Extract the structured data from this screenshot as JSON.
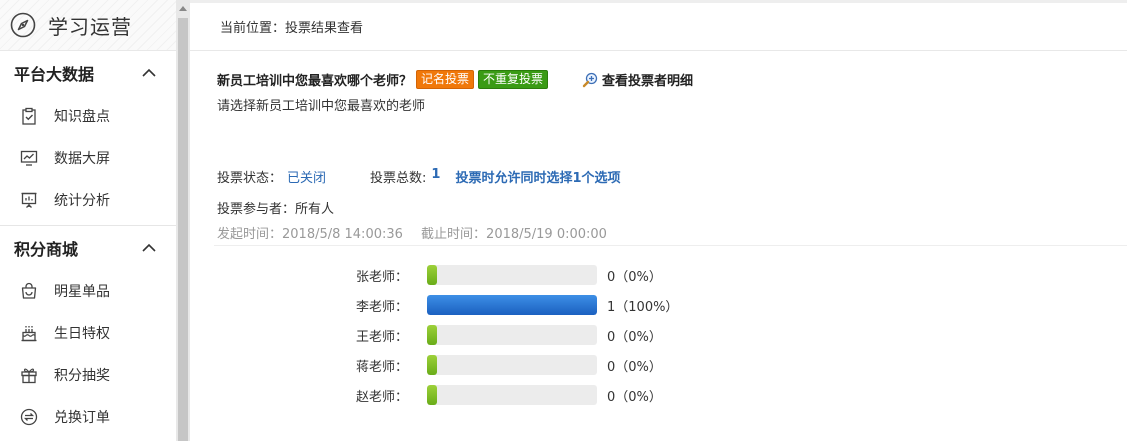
{
  "sidebar": {
    "app_title": "学习运营",
    "sections": [
      {
        "title": "平台大数据",
        "items": [
          {
            "label": "知识盘点",
            "icon": "clipboard-check-icon"
          },
          {
            "label": "数据大屏",
            "icon": "monitor-chart-icon"
          },
          {
            "label": "统计分析",
            "icon": "presentation-board-icon"
          }
        ]
      },
      {
        "title": "积分商城",
        "items": [
          {
            "label": "明星单品",
            "icon": "shopping-bag-icon"
          },
          {
            "label": "生日特权",
            "icon": "birthday-cake-icon"
          },
          {
            "label": "积分抽奖",
            "icon": "gift-box-icon"
          },
          {
            "label": "兑换订单",
            "icon": "exchange-icon"
          }
        ]
      }
    ]
  },
  "breadcrumb": "当前位置：投票结果查看",
  "vote": {
    "question": "新员工培训中您最喜欢哪个老师？",
    "badge_named": "记名投票",
    "badge_norepeat": "不重复投票",
    "detail_link": "查看投票者明细",
    "description": "请选择新员工培训中您最喜欢的老师",
    "status_label": "投票状态：",
    "status_value": "已关闭",
    "total_label": "投票总数:",
    "total_value": "1",
    "select_rule": "投票时允许同时选择1个选项",
    "participants": "投票参与者：所有人",
    "start_time": "发起时间：2018/5/8 14:00:36",
    "end_time": "截止时间：2018/5/19 0:00:00",
    "options": [
      {
        "name": "张老师：",
        "result": "0（0%）",
        "percent": 0
      },
      {
        "name": "李老师：",
        "result": "1（100%）",
        "percent": 100
      },
      {
        "name": "王老师：",
        "result": "0（0%）",
        "percent": 0
      },
      {
        "name": "蒋老师：",
        "result": "0（0%）",
        "percent": 0
      },
      {
        "name": "赵老师：",
        "result": "0（0%）",
        "percent": 0
      }
    ]
  },
  "colors": {
    "link_blue": "#2c6ab4",
    "badge_orange": "#f0780a",
    "badge_green": "#3a9b15",
    "bar_green": "#7fbf22",
    "bar_blue": "#2a76d4"
  }
}
